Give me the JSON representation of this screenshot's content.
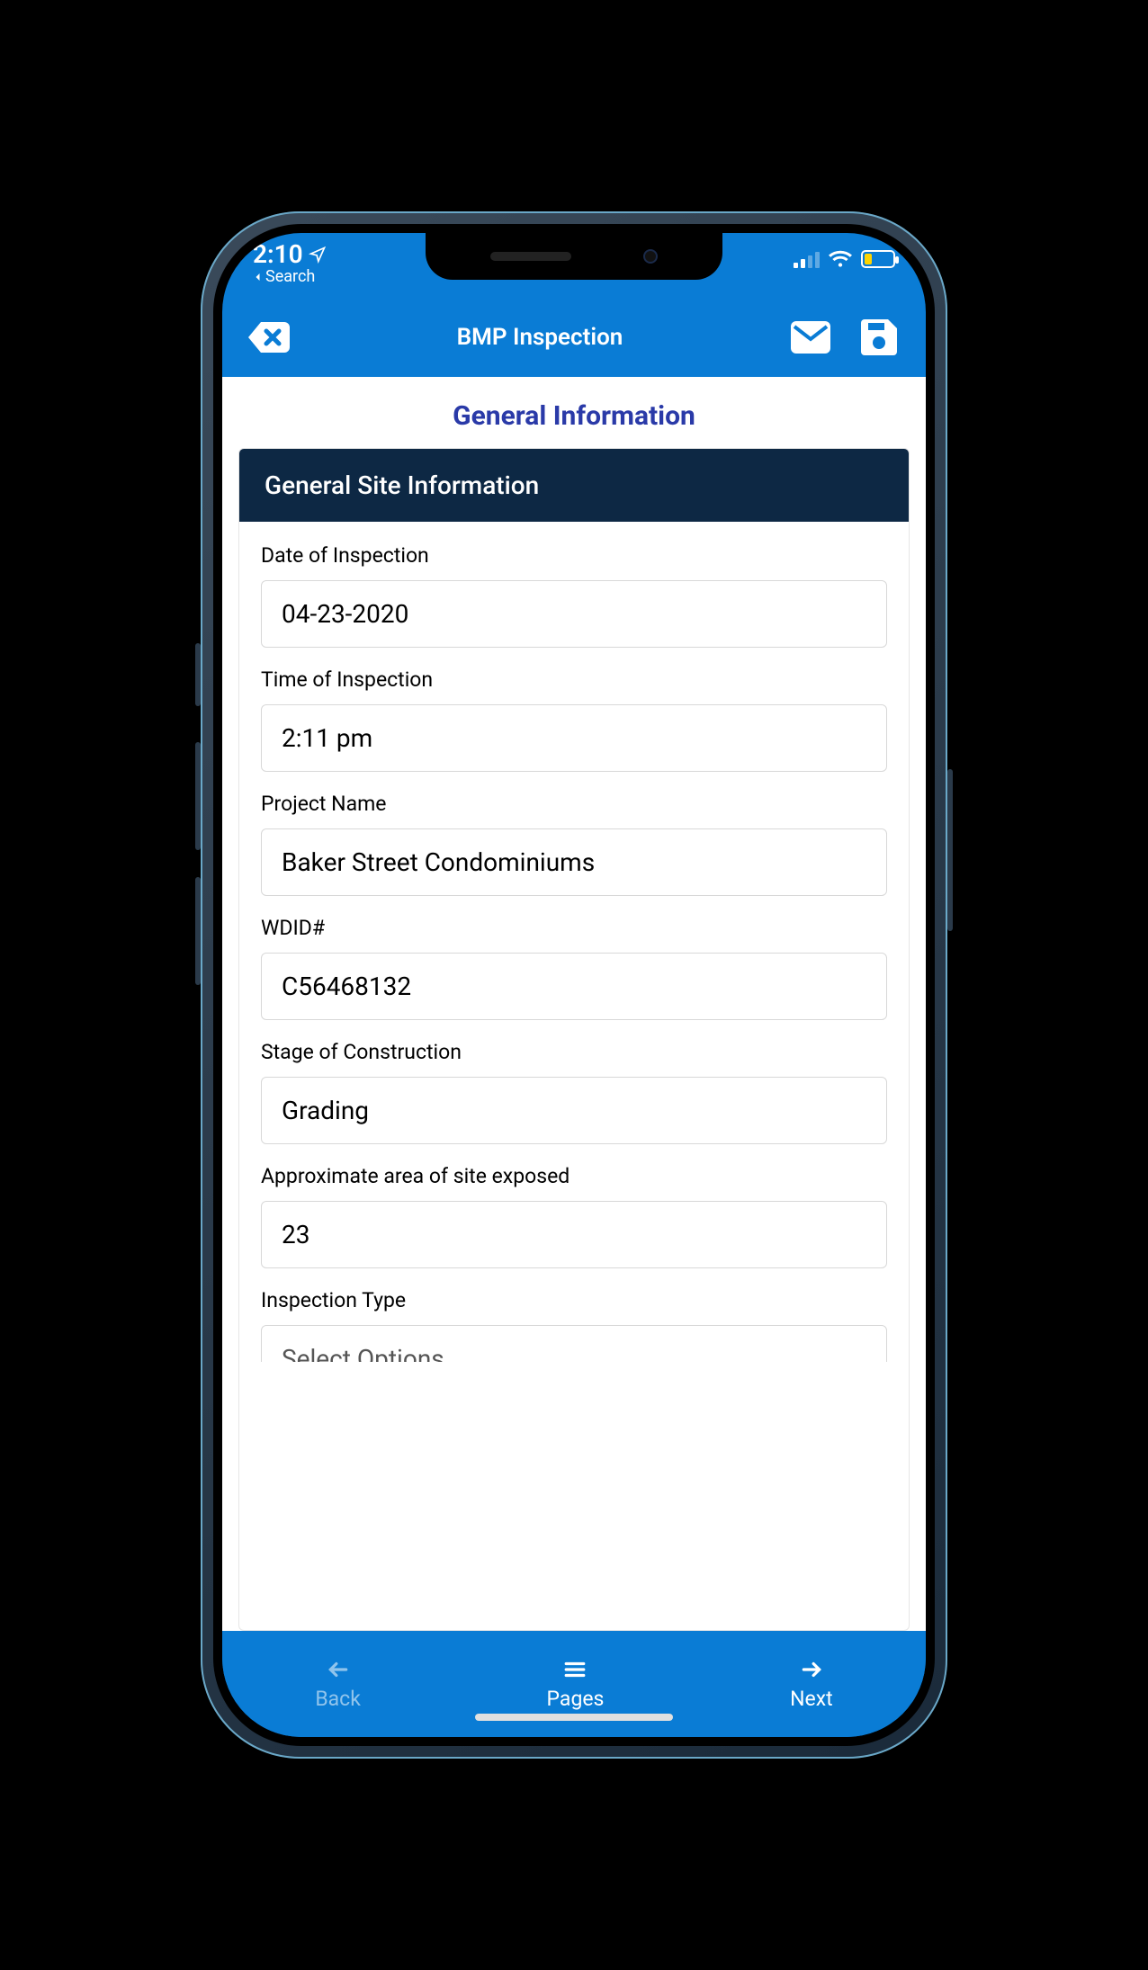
{
  "status": {
    "time": "2:10",
    "back_label": "Search"
  },
  "header": {
    "title": "BMP Inspection"
  },
  "page": {
    "title": "General Information"
  },
  "section": {
    "title": "General Site Information"
  },
  "fields": {
    "date": {
      "label": "Date of Inspection",
      "value": "04-23-2020"
    },
    "time": {
      "label": "Time of Inspection",
      "value": "2:11 pm"
    },
    "project": {
      "label": "Project Name",
      "value": "Baker Street Condominiums"
    },
    "wdid": {
      "label": "WDID#",
      "value": "C56468132"
    },
    "stage": {
      "label": "Stage of Construction",
      "value": "Grading"
    },
    "area": {
      "label": "Approximate area of site exposed",
      "value": "23"
    },
    "insp_type": {
      "label": "Inspection Type",
      "placeholder": "Select Options"
    }
  },
  "nav": {
    "back": "Back",
    "pages": "Pages",
    "next": "Next"
  }
}
